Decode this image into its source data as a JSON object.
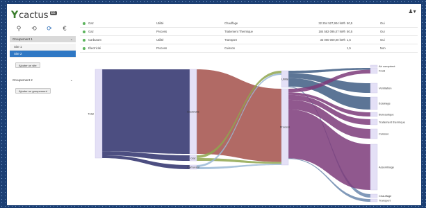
{
  "app": {
    "logo_text": "cactus",
    "logo_suffix": "EE",
    "user_icon": "user-icon"
  },
  "sidebar": {
    "tool_icons": [
      "map-pin-icon",
      "history-icon",
      "refresh-icon",
      "euro-icon"
    ],
    "groups": [
      {
        "label": "Groupement 1",
        "expanded": true,
        "sites": [
          {
            "label": "Site 1",
            "active": false
          },
          {
            "label": "Site 2",
            "active": true
          }
        ],
        "add_site_label": "Ajouter un site"
      },
      {
        "label": "Groupement 2",
        "expanded": false,
        "add_group_label": "Ajouter un groupement"
      }
    ]
  },
  "table": {
    "rows": [
      {
        "energy": "Gaz",
        "type": "Utilité",
        "usage": "Chauffage",
        "value": "32 254 527,904 kWh",
        "efficiency": "50,5",
        "checked": "Oui"
      },
      {
        "energy": "Gaz",
        "type": "Process",
        "usage": "Traitement Thermique",
        "value": "184 582 095,07 kWh",
        "efficiency": "50,5",
        "checked": "Oui"
      },
      {
        "energy": "Carburant",
        "type": "Utilité",
        "usage": "Transport",
        "value": "33 000 000,00 kWh",
        "efficiency": "1,5",
        "checked": "Oui"
      },
      {
        "energy": "Électricité",
        "type": "Process",
        "usage": "Cuisson",
        "value": "",
        "efficiency": "1,5",
        "checked": "Non"
      }
    ]
  },
  "sankey": {
    "nodes": [
      {
        "id": "total",
        "label": "Total"
      },
      {
        "id": "gaz",
        "label": "Gaz"
      },
      {
        "id": "elec",
        "label": "Électricité"
      },
      {
        "id": "carb",
        "label": "Carburant"
      },
      {
        "id": "utilite",
        "label": "Utilité"
      },
      {
        "id": "process",
        "label": "Process"
      },
      {
        "id": "froid",
        "label": "Froid"
      },
      {
        "id": "ventilation",
        "label": "Ventilation"
      },
      {
        "id": "eclairage",
        "label": "Éclairage"
      },
      {
        "id": "bureautique",
        "label": "Bureautique"
      },
      {
        "id": "traitement",
        "label": "Traitement thermique"
      },
      {
        "id": "cuisson",
        "label": "Cuisson"
      },
      {
        "id": "assemblage",
        "label": "Assemblage"
      },
      {
        "id": "chauffage",
        "label": "Chauffage"
      },
      {
        "id": "transport",
        "label": "Transport"
      },
      {
        "id": "air",
        "label": "Air comprimé"
      }
    ],
    "links": [
      {
        "source": "total",
        "target": "elec",
        "value": 120,
        "color": "#2d2f6b"
      },
      {
        "source": "total",
        "target": "gaz",
        "value": 6,
        "color": "#2d2f6b"
      },
      {
        "source": "total",
        "target": "carb",
        "value": 4,
        "color": "#2d2f6b"
      },
      {
        "source": "elec",
        "target": "process",
        "value": 120,
        "color": "#a3504a"
      },
      {
        "source": "gaz",
        "target": "utilite",
        "value": 3,
        "color": "#8fa64d"
      },
      {
        "source": "gaz",
        "target": "process",
        "value": 3,
        "color": "#8fa64d"
      },
      {
        "source": "carb",
        "target": "utilite",
        "value": 2,
        "color": "#9ab8d6"
      },
      {
        "source": "carb",
        "target": "process",
        "value": 2,
        "color": "#9ab8d6"
      },
      {
        "source": "utilite",
        "target": "froid",
        "value": 3,
        "color": "#3f5d84"
      },
      {
        "source": "utilite",
        "target": "ventilation",
        "value": 6,
        "color": "#3f5d84"
      },
      {
        "source": "utilite",
        "target": "eclairage",
        "value": 10,
        "color": "#3f5d84"
      },
      {
        "source": "utilite",
        "target": "chauffage",
        "value": 1,
        "color": "#6a87ad"
      },
      {
        "source": "process",
        "target": "froid",
        "value": 6,
        "color": "#7d3b7a"
      },
      {
        "source": "process",
        "target": "bureautique",
        "value": 4,
        "color": "#7d3b7a"
      },
      {
        "source": "process",
        "target": "traitement",
        "value": 8,
        "color": "#7d3b7a"
      },
      {
        "source": "process",
        "target": "cuisson",
        "value": 16,
        "color": "#7d3b7a"
      },
      {
        "source": "process",
        "target": "assemblage",
        "value": 80,
        "color": "#7d3b7a"
      },
      {
        "source": "process",
        "target": "transport",
        "value": 1,
        "color": "#6a87ad"
      }
    ]
  }
}
